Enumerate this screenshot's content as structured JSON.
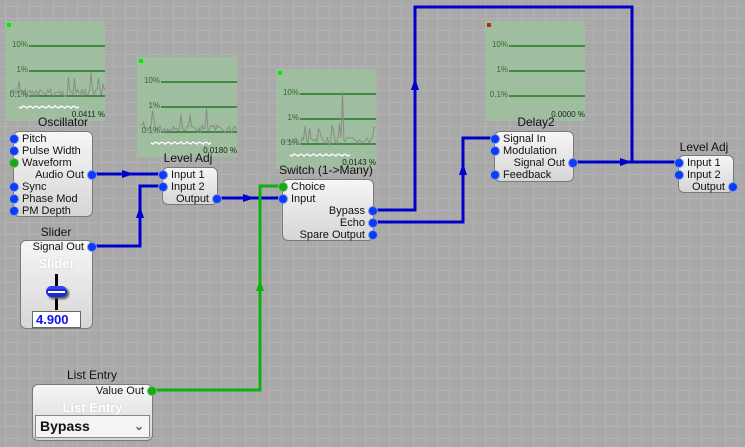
{
  "colors": {
    "wire_audio": "#0000cc",
    "wire_control": "#10b010",
    "graph_bg": "#9dc29d",
    "grid_line": "#0b6a0b"
  },
  "graphs": [
    {
      "id": "oscillator",
      "labels": [
        "10%",
        "1%",
        "0.1%"
      ],
      "reading": "0.0411 %",
      "indicator": "#00ee00"
    },
    {
      "id": "leveladj1",
      "labels": [
        "10%",
        "1%",
        "0.1%"
      ],
      "reading": "0.0180 %",
      "indicator": "#00ee00"
    },
    {
      "id": "switch",
      "labels": [
        "10%",
        "1%",
        "0.1%"
      ],
      "reading": "0.0143 %",
      "indicator": "#00ee00"
    },
    {
      "id": "delay2",
      "labels": [
        "10%",
        "1%",
        "0.1%"
      ],
      "reading": "0.0000 %",
      "indicator": "#bb2222"
    }
  ],
  "nodes": {
    "oscillator": {
      "title": "Oscillator",
      "inputs": [
        "Pitch",
        "Pulse Width",
        "Waveform",
        "Sync",
        "Phase Mod",
        "PM Depth"
      ],
      "output": "Audio Out"
    },
    "leveladj1": {
      "title": "Level Adj",
      "inputs": [
        "Input 1",
        "Input 2"
      ],
      "output": "Output"
    },
    "switch": {
      "title": "Switch (1->Many)",
      "inputs": [
        "Choice",
        "Input"
      ],
      "outputs": [
        "Bypass",
        "Echo",
        "Spare Output"
      ]
    },
    "delay2": {
      "title": "Delay2",
      "inputs": [
        "Signal In",
        "Modulation",
        "Feedback"
      ],
      "output": "Signal Out"
    },
    "leveladj2": {
      "title": "Level Adj",
      "inputs": [
        "Input 1",
        "Input 2"
      ],
      "output": "Output"
    },
    "slider": {
      "title": "Slider",
      "output": "Signal Out",
      "widget_label": "Slider",
      "value": "4.900"
    },
    "listentry": {
      "title": "List Entry",
      "output": "Value Out",
      "widget_label": "List Entry",
      "selected": "Bypass"
    }
  }
}
